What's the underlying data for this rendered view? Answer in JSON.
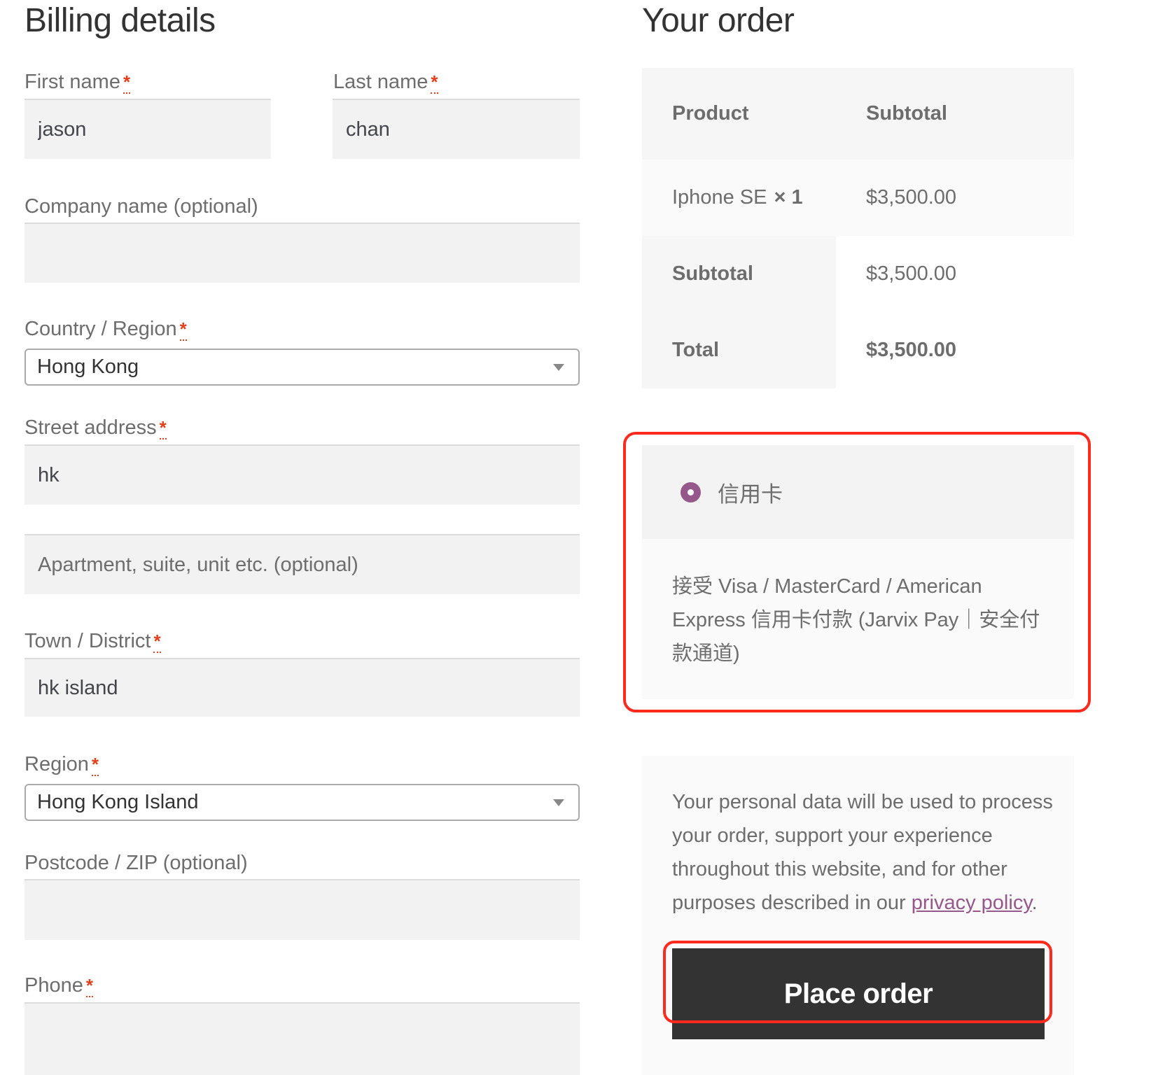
{
  "billing": {
    "title": "Billing details",
    "required_marker": "*",
    "first_name": {
      "label": "First name",
      "value": "jason"
    },
    "last_name": {
      "label": "Last name",
      "value": "chan"
    },
    "company": {
      "label": "Company name (optional)",
      "value": ""
    },
    "country": {
      "label": "Country / Region",
      "value": "Hong Kong"
    },
    "street": {
      "label": "Street address",
      "value": "hk",
      "line2_placeholder": "Apartment, suite, unit etc. (optional)"
    },
    "town": {
      "label": "Town / District",
      "value": "hk island"
    },
    "region": {
      "label": "Region",
      "value": "Hong Kong Island"
    },
    "postcode": {
      "label": "Postcode / ZIP (optional)",
      "value": ""
    },
    "phone": {
      "label": "Phone",
      "value": ""
    }
  },
  "order": {
    "title": "Your order",
    "headers": {
      "product": "Product",
      "subtotal": "Subtotal"
    },
    "items": [
      {
        "name": "Iphone SE",
        "qty": "× 1",
        "subtotal": "$3,500.00"
      }
    ],
    "subtotal": {
      "label": "Subtotal",
      "value": "$3,500.00"
    },
    "total": {
      "label": "Total",
      "value": "$3,500.00"
    }
  },
  "payment": {
    "method_label": "信用卡",
    "selected": true,
    "description": "接受 Visa / MasterCard / American Express 信用卡付款 (Jarvix Pay｜安全付款通道)"
  },
  "privacy": {
    "text_before": "Your personal data will be used to process your order, support your experience throughout this website, and for other purposes described in our ",
    "link_text": "privacy policy",
    "text_after": "."
  },
  "actions": {
    "place_order": "Place order"
  },
  "colors": {
    "accent": "#96588a",
    "required": "#e2401c",
    "button_bg": "#333333",
    "highlight": "#ff2a1f"
  }
}
